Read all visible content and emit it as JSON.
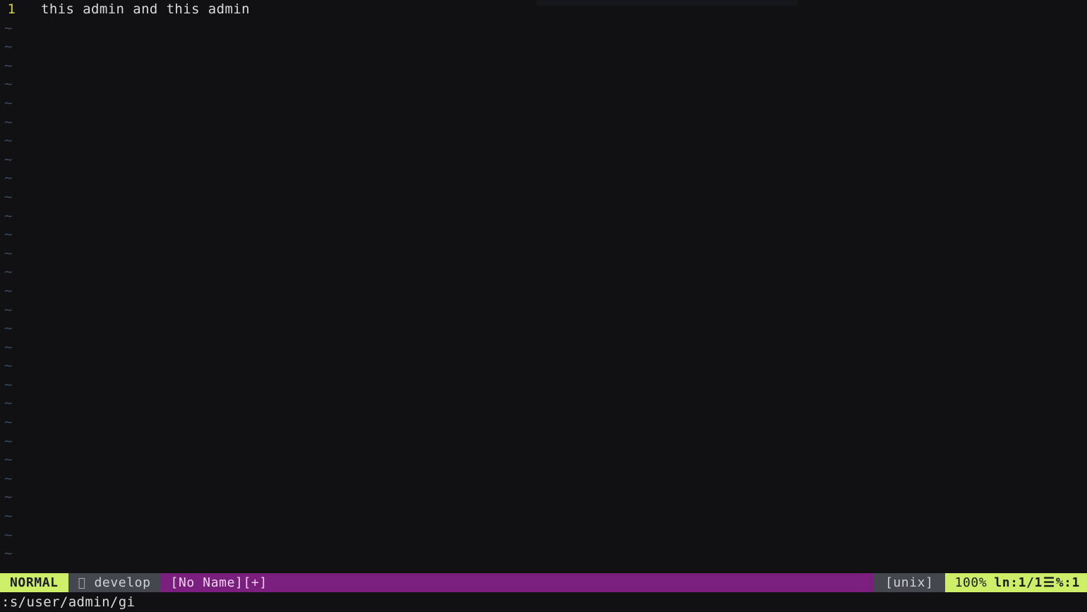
{
  "editor": {
    "background": "#111113",
    "foreground": "#dcdcdc",
    "line_number_color": "#d4d14a",
    "tilde_color": "#3f4a63",
    "lines": [
      {
        "number": "1",
        "text": "this admin and this admin"
      }
    ],
    "empty_marker": "~",
    "empty_marker_count": 29
  },
  "statusline": {
    "mode": "NORMAL",
    "mode_bg": "#cdee69",
    "mode_fg": "#1c1d20",
    "branch_glyph": "",
    "branch_icon_name": "git-branch-icon",
    "branch": "develop",
    "branch_bg": "#45474f",
    "filename": "[No Name][+]",
    "filename_bg": "#7b1f7e",
    "filename_fg": "#efd6f0",
    "fileformat": "[unix]",
    "fileformat_bg": "#45474f",
    "progress": "100%",
    "location_label": "ln",
    "location": ":1/1",
    "column_glyph": "☰",
    "column": "%:1",
    "position_bg": "#cdee69"
  },
  "cmdline": {
    "text": ":s/user/admin/gi"
  }
}
